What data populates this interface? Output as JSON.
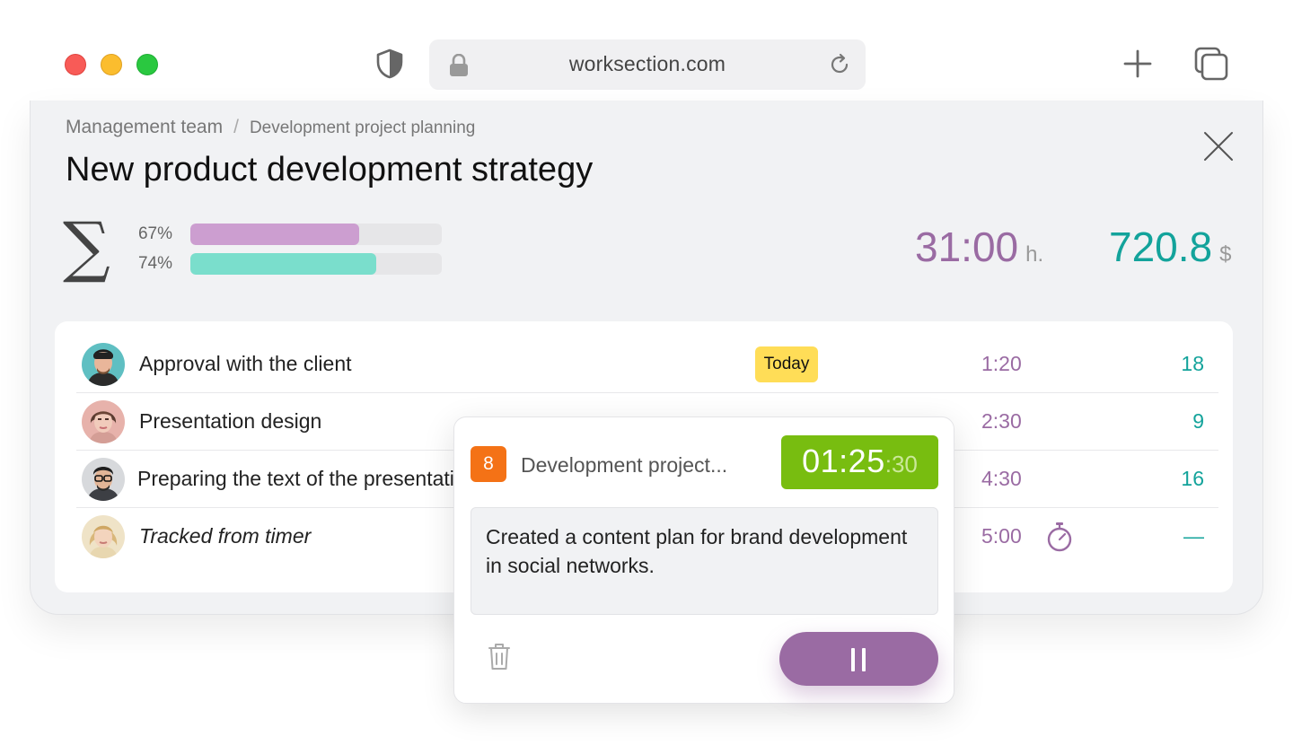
{
  "browser": {
    "url": "worksection.com",
    "icons": [
      "shield-icon",
      "lock-icon",
      "reload-icon",
      "plus-icon",
      "tabs-icon"
    ]
  },
  "breadcrumb": {
    "parent": "Management team",
    "separator": "/",
    "current": "Development project planning"
  },
  "page": {
    "title": "New product development strategy"
  },
  "summary": {
    "symbol": "∑",
    "bars": [
      {
        "label": "67%",
        "value": 0.67,
        "color": "#cc9ed0"
      },
      {
        "label": "74%",
        "value": 0.74,
        "color": "#7adecc"
      }
    ],
    "hours": {
      "value": "31:00",
      "unit": "h."
    },
    "money": {
      "value": "720.8",
      "unit": "$"
    }
  },
  "tasks": [
    {
      "name": "Approval with the client",
      "badge": "Today",
      "time": "1:20",
      "count": "18",
      "italic": false
    },
    {
      "name": "Presentation design",
      "badge": "",
      "time": "2:30",
      "count": "9",
      "italic": false
    },
    {
      "name": "Preparing the text of the presentation",
      "badge": "",
      "time": "4:30",
      "count": "16",
      "italic": false
    },
    {
      "name": "Tracked from timer",
      "badge": "",
      "time": "5:00",
      "count": "—",
      "italic": true,
      "icon": "stopwatch-icon"
    }
  ],
  "timer": {
    "project_number": "8",
    "project_name": "Development project...",
    "time_main": "01:25",
    "time_seconds": ":30",
    "note": "Created a content plan for brand development in social networks.",
    "actions": [
      "trash-icon",
      "pause-icon"
    ]
  },
  "colors": {
    "purple": "#9a6ba3",
    "teal": "#13a39b",
    "badge_yellow": "#ffdd57",
    "project_orange": "#f47216",
    "timer_green": "#78bd10"
  }
}
